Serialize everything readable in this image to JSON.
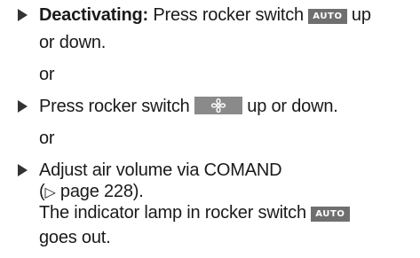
{
  "list": {
    "item1": {
      "label": "Deactivating:",
      "text_a": " Press rocker switch ",
      "key": "AUTO",
      "text_b": " up",
      "text_c": "or down."
    },
    "or1": "or",
    "item2": {
      "text_a": "Press rocker switch ",
      "text_b": " up or down."
    },
    "or2": "or",
    "item3": {
      "text_a": "Adjust air volume via COMAND",
      "ref_open": "(",
      "ref_symbol": "▷",
      "ref_text": " page 228).",
      "result_a": "The indicator lamp in rocker switch ",
      "key": "AUTO",
      "result_b": "goes out."
    }
  },
  "icons": {
    "fan": "fan-icon",
    "bullet": "triangle-bullet-icon"
  },
  "colors": {
    "text": "#1a1a1a",
    "key_background": "#6f6f6f",
    "fan_key_background": "#8a8a8a"
  }
}
